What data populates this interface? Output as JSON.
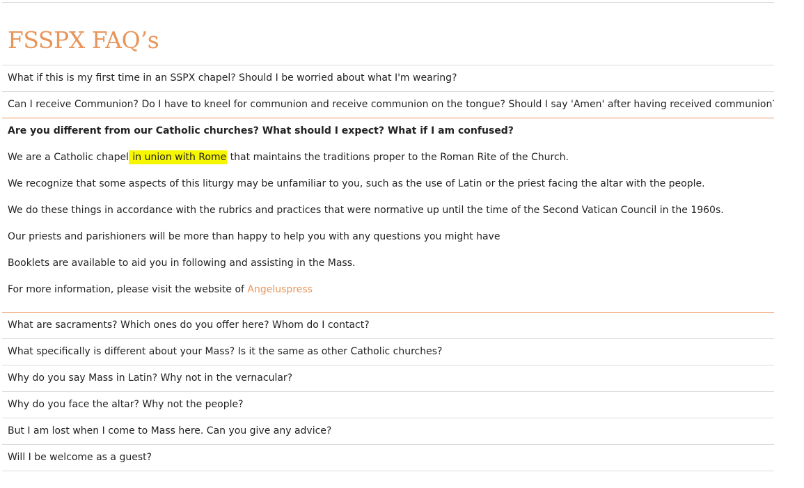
{
  "page": {
    "title": "FSSPX FAQ’s"
  },
  "faq": [
    {
      "question": "What if this is my first time in an SSPX chapel? Should I be worried about what I'm wearing?",
      "expanded": false
    },
    {
      "question": "Can I receive Communion? Do I have to kneel for communion and receive communion on the tongue? Should I say 'Amen' after having received communion?",
      "expanded": false
    },
    {
      "question": "Are you different from our Catholic churches? What should I expect? What if I am confused?",
      "expanded": true
    },
    {
      "question": "What are sacraments? Which ones do you offer here? Whom do I contact?",
      "expanded": false
    },
    {
      "question": "What specifically is different about your Mass? Is it the same as other Catholic churches?",
      "expanded": false
    },
    {
      "question": "Why do you say Mass in Latin? Why not in the vernacular?",
      "expanded": false
    },
    {
      "question": "Why do you face the altar? Why not the people?",
      "expanded": false
    },
    {
      "question": "But I am lost when I come to Mass here. Can you give any advice?",
      "expanded": false
    },
    {
      "question": "Will I be welcome as a guest?",
      "expanded": false
    }
  ],
  "answer": {
    "p1_before": "We are a Catholic chapel",
    "p1_highlight": " in union with Rome",
    "p1_after": " that maintains the traditions proper to the Roman Rite of the Church.",
    "p2": "We recognize that some aspects of this liturgy may be unfamiliar to you, such as the use of Latin or the priest facing the altar with the people.",
    "p3": "We do these things in accordance with the rubrics and practices that were normative up until the time of the Second Vatican Council in the 1960s.",
    "p4": "Our priests and parishioners will be more than happy to help you with any questions you might have",
    "p5": "Booklets are available to aid you in following and assisting in the Mass.",
    "p6_before": "For more information, please visit the website of ",
    "p6_link": "Angeluspress"
  },
  "colors": {
    "accent": "#e8955a",
    "highlight": "#f6f600",
    "text": "#222222",
    "divider": "#dcdcdc"
  }
}
